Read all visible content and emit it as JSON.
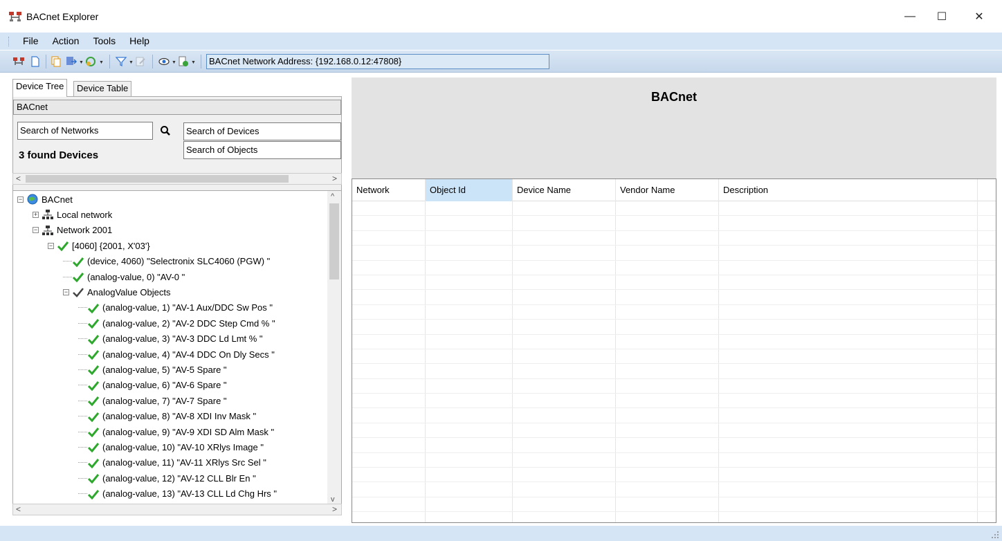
{
  "window": {
    "title": "BACnet Explorer",
    "minimize": "—",
    "maximize": "☐",
    "close": "✕"
  },
  "menu": {
    "items": [
      "File",
      "Action",
      "Tools",
      "Help"
    ]
  },
  "toolbar": {
    "address": "BACnet Network Address: {192.168.0.12:47808}"
  },
  "left": {
    "tabs": [
      "Device Tree",
      "Device Table"
    ],
    "group_label": "BACnet",
    "search_networks": "Search of Networks",
    "search_devices": "Search of Devices",
    "search_objects": "Search of Objects",
    "found": "3 found Devices",
    "tree": [
      {
        "label": "BACnet",
        "indent": 0,
        "expander": "−",
        "icon": "globe-icon"
      },
      {
        "label": "Local network",
        "indent": 1,
        "expander": "+",
        "icon": "network-icon"
      },
      {
        "label": "Network 2001",
        "indent": 1,
        "expander": "−",
        "icon": "network-icon"
      },
      {
        "label": "[4060] {2001, X'03'}",
        "indent": 2,
        "expander": "−",
        "icon": "check-icon"
      },
      {
        "label": "(device, 4060) \"Selectronix SLC4060 (PGW) \"",
        "indent": 3,
        "expander": "",
        "icon": "check-icon"
      },
      {
        "label": "(analog-value, 0) \"AV-0  \"",
        "indent": 3,
        "expander": "",
        "icon": "check-icon"
      },
      {
        "label": "AnalogValue Objects",
        "indent": 3,
        "expander": "−",
        "icon": "check-dark-icon"
      },
      {
        "label": "(analog-value, 1) \"AV-1 Aux/DDC Sw Pos \"",
        "indent": 4,
        "expander": "",
        "icon": "check-icon"
      },
      {
        "label": "(analog-value, 2) \"AV-2 DDC Step Cmd % \"",
        "indent": 4,
        "expander": "",
        "icon": "check-icon"
      },
      {
        "label": "(analog-value, 3) \"AV-3 DDC Ld Lmt % \"",
        "indent": 4,
        "expander": "",
        "icon": "check-icon"
      },
      {
        "label": "(analog-value, 4) \"AV-4 DDC On Dly Secs \"",
        "indent": 4,
        "expander": "",
        "icon": "check-icon"
      },
      {
        "label": "(analog-value, 5) \"AV-5 Spare \"",
        "indent": 4,
        "expander": "",
        "icon": "check-icon"
      },
      {
        "label": "(analog-value, 6) \"AV-6 Spare \"",
        "indent": 4,
        "expander": "",
        "icon": "check-icon"
      },
      {
        "label": "(analog-value, 7) \"AV-7 Spare \"",
        "indent": 4,
        "expander": "",
        "icon": "check-icon"
      },
      {
        "label": "(analog-value, 8) \"AV-8 XDI Inv Mask \"",
        "indent": 4,
        "expander": "",
        "icon": "check-icon"
      },
      {
        "label": "(analog-value, 9) \"AV-9 XDI SD Alm Mask \"",
        "indent": 4,
        "expander": "",
        "icon": "check-icon"
      },
      {
        "label": "(analog-value, 10) \"AV-10 XRlys Image \"",
        "indent": 4,
        "expander": "",
        "icon": "check-icon"
      },
      {
        "label": "(analog-value, 11) \"AV-11 XRlys Src Sel \"",
        "indent": 4,
        "expander": "",
        "icon": "check-icon"
      },
      {
        "label": "(analog-value, 12) \"AV-12 CLL Blr En \"",
        "indent": 4,
        "expander": "",
        "icon": "check-icon"
      },
      {
        "label": "(analog-value, 13) \"AV-13 CLL Ld Chg Hrs \"",
        "indent": 4,
        "expander": "",
        "icon": "check-icon"
      }
    ]
  },
  "right": {
    "title": "BACnet",
    "columns": [
      "Network",
      "Object Id",
      "Device Name",
      "Vendor Name",
      "Description"
    ],
    "selected_column": "Object Id"
  },
  "colors": {
    "menubar": "#d6e5f5",
    "check_green": "#2da82d",
    "header_selected": "#cce4f7"
  }
}
